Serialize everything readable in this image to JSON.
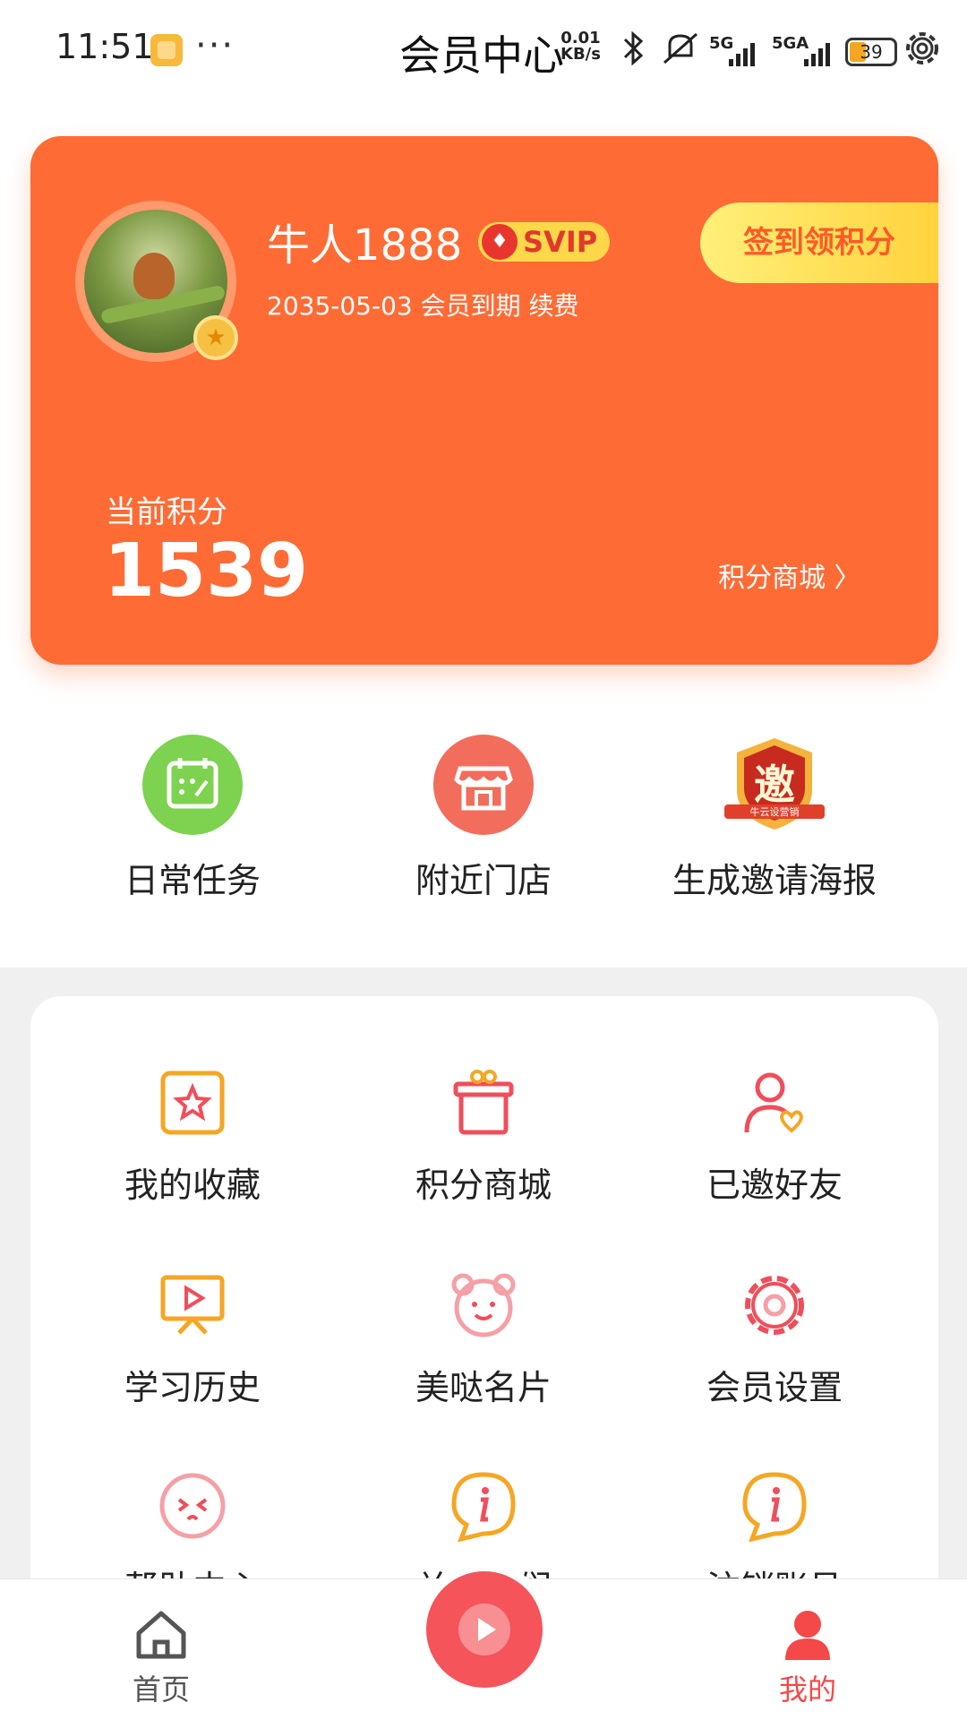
{
  "status_bar": {
    "time": "11:51",
    "dots": "···",
    "title": "会员中心",
    "speed_value": "0.01",
    "speed_unit": "KB/s",
    "signal_1": "5G",
    "signal_2": "5GA",
    "battery": "39"
  },
  "member": {
    "username": "牛人1888",
    "badge": "SVIP",
    "expire_line": "2035-05-03 会员到期 续费",
    "signin_label": "签到领积分",
    "points_label": "当前积分",
    "points_value": "1539",
    "mall_link": "积分商城 〉"
  },
  "shortcuts": [
    {
      "label": "日常任务",
      "icon": "calendar-icon"
    },
    {
      "label": "附近门店",
      "icon": "store-icon"
    },
    {
      "label": "生成邀请海报",
      "icon": "invite-poster-icon",
      "badge_text": "邀",
      "badge_sub": "牛云设营销"
    }
  ],
  "grid": [
    {
      "label": "我的收藏",
      "icon": "star-icon"
    },
    {
      "label": "积分商城",
      "icon": "gift-box-icon"
    },
    {
      "label": "已邀好友",
      "icon": "user-heart-icon"
    },
    {
      "label": "学习历史",
      "icon": "video-screen-icon"
    },
    {
      "label": "美哒名片",
      "icon": "bear-face-icon"
    },
    {
      "label": "会员设置",
      "icon": "gear-icon"
    },
    {
      "label": "帮助中心",
      "icon": "help-face-icon"
    },
    {
      "label": "关于我们",
      "icon": "info-bubble-icon"
    },
    {
      "label": "注销账号",
      "icon": "info-bubble-icon"
    }
  ],
  "nav": {
    "home": "首页",
    "mine": "我的"
  },
  "colors": {
    "brand_orange": "#ff6b35",
    "accent_red": "#f44949",
    "signin_yellow": "#ffd33d"
  }
}
